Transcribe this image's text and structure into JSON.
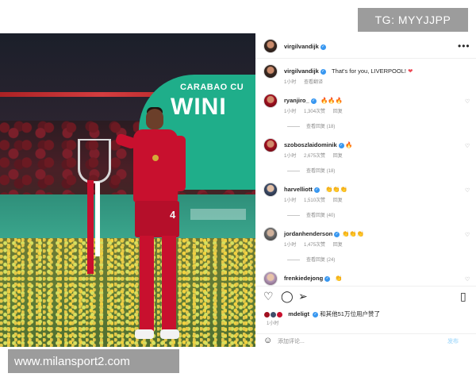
{
  "watermarks": {
    "top": "TG: MYYJJPP",
    "bottom": "www.milansport2.com"
  },
  "photo": {
    "banner_small": "CARABAO CU",
    "banner_big": "WINI",
    "shirt_number": "4"
  },
  "post": {
    "author": "virgilvandijk",
    "more_icon": "more-horizontal-icon",
    "comments": [
      {
        "user": "virgilvandijk",
        "text": "That's for you, LIVERPOOL!",
        "emoji": "❤",
        "time": "1小时",
        "likes": "",
        "reply": "查看翻译",
        "replies": ""
      },
      {
        "user": "ryanjiro_",
        "text": "",
        "emoji": "🔥🔥🔥",
        "time": "1小时",
        "likes": "1,304次赞",
        "reply": "回复",
        "replies": "查看回复 (18)"
      },
      {
        "user": "szoboszlaidominik",
        "text": "",
        "emoji": "🔥",
        "time": "1小时",
        "likes": "2,675次赞",
        "reply": "回复",
        "replies": "查看回复 (18)"
      },
      {
        "user": "harvelliott",
        "text": "",
        "emoji": "👏👏👏",
        "time": "1小时",
        "likes": "1,510次赞",
        "reply": "回复",
        "replies": "查看回复 (40)"
      },
      {
        "user": "jordanhenderson",
        "text": "",
        "emoji": "👏👏👏",
        "time": "1小时",
        "likes": "1,475次赞",
        "reply": "回复",
        "replies": "查看回复 (24)"
      },
      {
        "user": "frenkiedejong",
        "text": "",
        "emoji": "👏",
        "time": "",
        "likes": "",
        "reply": "",
        "replies": ""
      }
    ],
    "actions": {
      "like": "heart-icon",
      "comment": "comment-icon",
      "share": "send-icon",
      "save": "bookmark-icon"
    },
    "likes_line": {
      "user": "mdeligt",
      "text": "和其他51万位用户赞了"
    },
    "likes_time": "1小时",
    "add_comment": {
      "placeholder": "添加评论...",
      "post_label": "发布"
    }
  },
  "colors": {
    "verified": "#3897f0",
    "heart": "#ed4956",
    "watermark_bg": "#9c9c9c",
    "liverpool_red": "#c8102e"
  }
}
